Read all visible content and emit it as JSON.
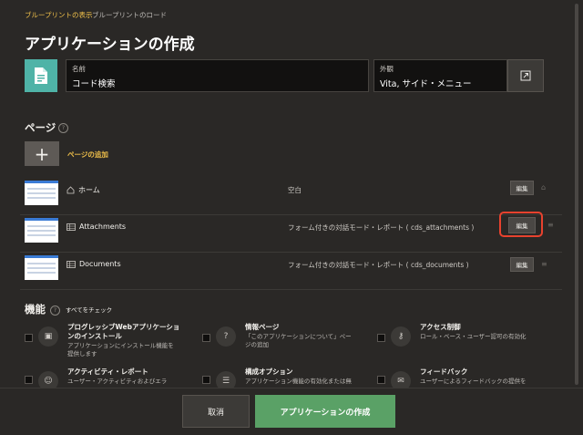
{
  "breadcrumb": {
    "active": "ブループリントの表示",
    "inactive": "ブループリントのロード"
  },
  "page_title": "アプリケーションの作成",
  "name_field": {
    "label": "名前",
    "value": "コード検索"
  },
  "appearance_field": {
    "label": "外観",
    "value": "Vita, サイド・メニュー"
  },
  "pages_section": {
    "title": "ページ",
    "add_label": "ページの追加",
    "rows": [
      {
        "name": "ホーム",
        "type": "空白",
        "edit": "編集",
        "icon": "home-icon"
      },
      {
        "name": "Attachments",
        "type": "フォーム付きの対話モード・レポート ( cds_attachments )",
        "edit": "編集",
        "icon": "report-icon"
      },
      {
        "name": "Documents",
        "type": "フォーム付きの対話モード・レポート ( cds_documents )",
        "edit": "編集",
        "icon": "report-icon"
      }
    ]
  },
  "features_section": {
    "title": "機能",
    "check_all": "すべてをチェック",
    "items": [
      {
        "title_lines": [
          "プログレッシブWebアプリケーショ",
          "ンのインストール"
        ],
        "desc_lines": [
          "アプリケーションにインストール機能を",
          "提供します"
        ],
        "icon": "install-icon"
      },
      {
        "title_lines": [
          "情報ページ"
        ],
        "desc_lines": [
          "「このアプリケーションについて」ペー",
          "ジの追加"
        ],
        "icon": "info-icon"
      },
      {
        "title_lines": [
          "アクセス制御"
        ],
        "desc_lines": [
          "ロール・ベース・ユーザー認可の有効化"
        ],
        "icon": "key-icon"
      },
      {
        "title_lines": [
          "アクティビティ・レポート"
        ],
        "desc_lines": [
          "ユーザー・アクティビティおよびエラ"
        ],
        "icon": "user-chart-icon"
      },
      {
        "title_lines": [
          "構成オプション"
        ],
        "desc_lines": [
          "アプリケーション機能の有効化または無"
        ],
        "icon": "sliders-icon"
      },
      {
        "title_lines": [
          "フィードバック"
        ],
        "desc_lines": [
          "ユーザーによるフィードバックの提供を"
        ],
        "icon": "chat-icon"
      }
    ]
  },
  "footer": {
    "cancel_label": "取消",
    "create_label": "アプリケーションの作成"
  },
  "colors": {
    "accent": "#f0c04a",
    "primary_button": "#5aa166",
    "app_icon": "#4fb3a7",
    "highlight": "#e8422e"
  }
}
